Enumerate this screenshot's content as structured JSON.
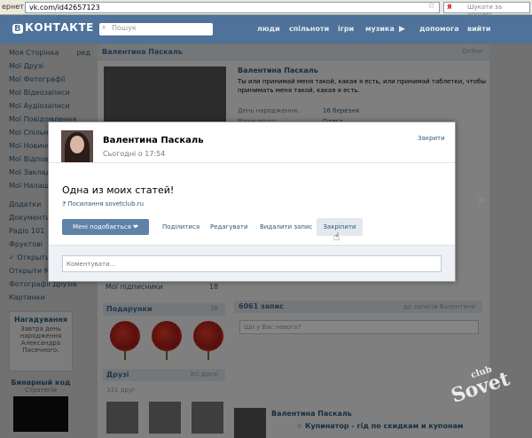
{
  "browser": {
    "menu_label": "ернет",
    "url": "vk.com/id42657123",
    "star_icon": "star-icon",
    "search_engine_letter": "Я",
    "search_placeholder": "Шукати за допомо"
  },
  "vk_header": {
    "logo_badge": "В",
    "logo_text": "КОНТАКТЕ",
    "search_placeholder": "Пошук",
    "nav": [
      "люди",
      "спільноти",
      "ігри",
      "музика",
      "допомога",
      "вийти"
    ],
    "nav_arrow": "▶"
  },
  "left_menu": {
    "items": [
      {
        "label": "Моя Сторінка",
        "right": "ред"
      },
      {
        "label": "Мої Друзі",
        "right": ""
      },
      {
        "label": "Мої Фотографії",
        "right": ""
      },
      {
        "label": "Мої Відеозаписи",
        "right": ""
      },
      {
        "label": "Мої Аудіозаписи",
        "right": ""
      },
      {
        "label": "Мої Повідомлення",
        "right": ""
      },
      {
        "label": "Мої Спільноти",
        "right": ""
      },
      {
        "label": "Мої Новини",
        "right": ""
      },
      {
        "label": "Мої Відповіді",
        "right": ""
      },
      {
        "label": "Мої Закладки",
        "right": ""
      },
      {
        "label": "Мої Налаштування",
        "right": ""
      },
      {
        "label": "Додатки",
        "right": ""
      },
      {
        "label": "Документи",
        "right": ""
      },
      {
        "label": "Радіо 101",
        "right": ""
      },
      {
        "label": "Фруктові",
        "right": ""
      },
      {
        "label": "✓ Открыть",
        "right": ""
      },
      {
        "label": "Открыти Ка",
        "right": ""
      },
      {
        "label": "Фотографії Друзів",
        "right": ""
      },
      {
        "label": "Картинки",
        "right": ""
      }
    ]
  },
  "reminder": {
    "title": "Нагадування",
    "text": "Завтра день народження Александра Пасечного."
  },
  "binary": {
    "title": "Бинарный код",
    "subtitle": "Стратегія"
  },
  "profile": {
    "header_name": "Валентина Паскаль",
    "header_online": "Online",
    "name": "Валентина Паскаль",
    "status": "Ты или принимай меня такой, какая я есть, или принимай таблетки, чтобы принимать меня такой, какая я есть.",
    "details": [
      {
        "label": "День народження:",
        "value": "16 березня"
      },
      {
        "label": "Рідне місто:",
        "value": "Одеса"
      }
    ],
    "subscriptions": "Мої підписники",
    "subscriptions_count": "18",
    "gifts_title": "Подарунки",
    "gifts_count": "38",
    "friends_title": "Друзі",
    "friends_all": "Усі друзі",
    "friends_count": "331 друг",
    "wall_count": "6061 запис",
    "wall_filter": "до записів Валентини",
    "wall_placeholder": "Що у Вас нового?",
    "post_author": "Валентина Паскаль",
    "post_link": "☆ Купинатор - гід по скидкам и купонам"
  },
  "modal": {
    "author": "Валентина Паскаль",
    "time": "Сьогодні о 17:54",
    "close": "Закрити",
    "text": "Одна из моих статей!",
    "link_icon": "paperclip-icon",
    "link": "Посилання sovetclub.ru",
    "like_button": "Мені подобається ❤",
    "share": "Поділитися",
    "edit": "Редагувати",
    "delete": "Видалити запис",
    "pin": "Закріпити",
    "comment_placeholder": "Коментувати..."
  },
  "watermark": {
    "main": "Sovet",
    "small": "club"
  },
  "colors": {
    "vk_blue": "#4e729a",
    "link": "#2b587a",
    "like_button": "#5f82a8",
    "overlay": "rgba(0,0,0,0.48)"
  }
}
